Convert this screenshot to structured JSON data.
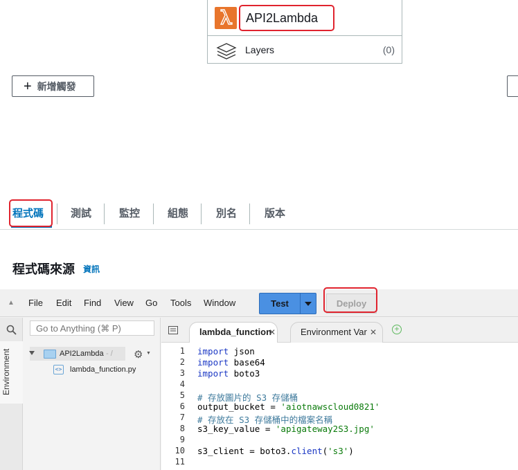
{
  "designer": {
    "function_name": "API2Lambda",
    "layers_label": "Layers",
    "layers_count": "(0)",
    "add_trigger_label": "新增觸發"
  },
  "tabs": [
    {
      "label": "程式碼",
      "active": true
    },
    {
      "label": "測試"
    },
    {
      "label": "監控"
    },
    {
      "label": "組態"
    },
    {
      "label": "別名"
    },
    {
      "label": "版本"
    }
  ],
  "section": {
    "title": "程式碼來源",
    "info_link": "資訊"
  },
  "ide": {
    "menu": [
      "File",
      "Edit",
      "Find",
      "View",
      "Go",
      "Tools",
      "Window"
    ],
    "test_label": "Test",
    "deploy_label": "Deploy",
    "search_placeholder": "Go to Anything (⌘ P)",
    "environment_label": "Environment",
    "tree": {
      "folder_name": "API2Lambda",
      "folder_suffix": "- /",
      "file_name": "lambda_function.py"
    },
    "editor_tabs": [
      {
        "label": "lambda_function",
        "active": true
      },
      {
        "label": "Environment Var",
        "active": false
      }
    ],
    "line_numbers": [
      "1",
      "2",
      "3",
      "4",
      "5",
      "6",
      "7",
      "8",
      "9",
      "10",
      "11"
    ],
    "code_lines": [
      "import json",
      "import base64",
      "import boto3",
      "",
      "# 存放圖片的 S3 存儲桶",
      "output_bucket = 'aiotnawscloud0821'",
      "# 存放在 S3 存儲桶中的檔案名稱",
      "s3_key_value = 'apigateway2S3.jpg'",
      "",
      "s3_client = boto3.client('s3')",
      ""
    ]
  },
  "colors": {
    "highlight_outline": "#e0232e",
    "tab_active": "#0073bb",
    "lambda_orange": "#e8752c",
    "test_button": "#4a90e2"
  }
}
